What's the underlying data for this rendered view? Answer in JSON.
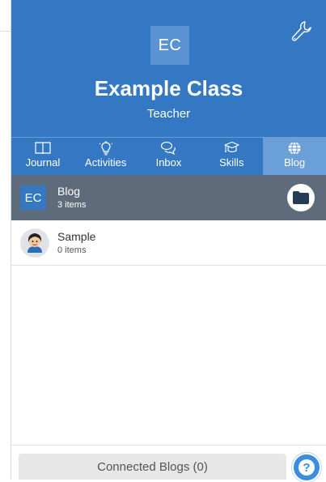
{
  "header": {
    "avatar_initials": "EC",
    "class_name": "Example Class",
    "role": "Teacher"
  },
  "nav": {
    "items": [
      {
        "label": "Journal",
        "icon": "book-icon"
      },
      {
        "label": "Activities",
        "icon": "lightbulb-icon"
      },
      {
        "label": "Inbox",
        "icon": "chat-bubbles-icon"
      },
      {
        "label": "Skills",
        "icon": "graduation-cap-icon"
      },
      {
        "label": "Blog",
        "icon": "globe-icon"
      }
    ],
    "active": "Blog"
  },
  "blog": {
    "initials": "EC",
    "name": "Blog",
    "count": "3 items"
  },
  "students": [
    {
      "name": "Sample",
      "count": "0 items"
    }
  ],
  "footer": {
    "connected_label": "Connected Blogs (0)",
    "help_label": "?"
  },
  "colors": {
    "primary": "#3478c4",
    "nav_active": "#6a9fd8",
    "blog_row": "#5d6b7a"
  }
}
